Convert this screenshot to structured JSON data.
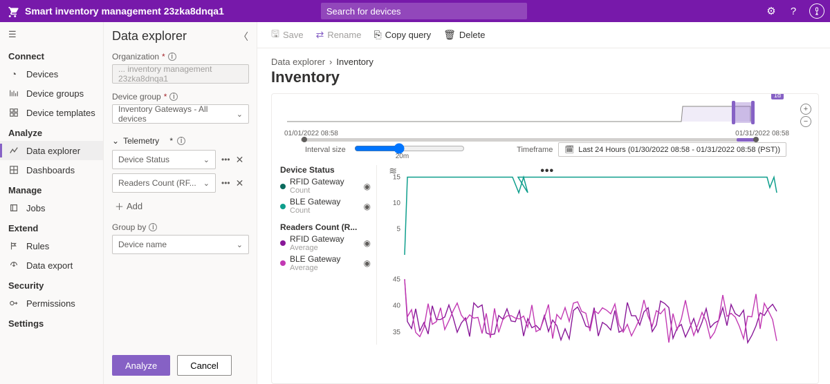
{
  "topbar": {
    "app_title": "Smart inventory management 23zka8dnqa1",
    "search_placeholder": "Search for devices"
  },
  "nav": {
    "sections": {
      "connect": "Connect",
      "analyze": "Analyze",
      "manage": "Manage",
      "extend": "Extend",
      "security": "Security",
      "settings": "Settings"
    },
    "items": {
      "devices": "Devices",
      "device_groups": "Device groups",
      "device_templates": "Device templates",
      "data_explorer": "Data explorer",
      "dashboards": "Dashboards",
      "jobs": "Jobs",
      "rules": "Rules",
      "data_export": "Data export",
      "permissions": "Permissions"
    }
  },
  "data_explorer": {
    "title": "Data explorer",
    "labels": {
      "organization": "Organization",
      "device_group": "Device group",
      "telemetry": "Telemetry",
      "group_by": "Group by",
      "add": "Add"
    },
    "org_value": "... inventory management 23zka8dnqa1",
    "device_group_value": "Inventory Gateways - All devices",
    "telemetry": [
      {
        "label": "Device Status"
      },
      {
        "label": "Readers Count (RF..."
      }
    ],
    "group_by_value": "Device name",
    "buttons": {
      "analyze": "Analyze",
      "cancel": "Cancel"
    }
  },
  "cmdbar": {
    "save": "Save",
    "rename": "Rename",
    "copy": "Copy query",
    "delete": "Delete"
  },
  "page": {
    "crumb_root": "Data explorer",
    "crumb_current": "Inventory",
    "title": "Inventory",
    "timeline_start": "01/01/2022 08:58",
    "timeline_end": "01/31/2022 08:58",
    "timeline_badge": "1d",
    "interval_label": "Interval size",
    "interval_value": "20m",
    "timeframe_label": "Timeframe",
    "timeframe_value": "Last 24 Hours (01/30/2022 08:58 - 01/31/2022 08:58 (PST))"
  },
  "legend": {
    "group1": {
      "title": "Device Status",
      "a": "RFID Gateway",
      "a_sub": "Count",
      "b": "BLE Gateway",
      "b_sub": "Count"
    },
    "group2": {
      "title": "Readers Count (R...",
      "a": "RFID Gateway",
      "a_sub": "Average",
      "b": "BLE Gateway",
      "b_sub": "Average"
    }
  },
  "colors": {
    "brand": "#7719aa",
    "accent": "#8661c5",
    "teal_dark": "#0b6a5d",
    "teal": "#0e9e8c",
    "magenta_dark": "#881798",
    "magenta": "#c239b3"
  },
  "chart_data": [
    {
      "type": "line",
      "title": "Device Status",
      "ylabel": "Count",
      "ylim": [
        0,
        16
      ],
      "series": [
        {
          "name": "RFID Gateway",
          "color": "#0b6a5d"
        },
        {
          "name": "BLE Gateway",
          "color": "#0e9e8c"
        }
      ],
      "yticks": [
        5,
        10,
        15
      ],
      "note": "single flat line near y≈15 with one brief dip to ~12 around x≈0.3"
    },
    {
      "type": "line",
      "title": "Readers Count (RFID/BLE)",
      "ylabel": "Average",
      "ylim": [
        32,
        47
      ],
      "yticks": [
        35,
        40,
        45
      ],
      "series": [
        {
          "name": "RFID Gateway",
          "color": "#881798"
        },
        {
          "name": "BLE Gateway",
          "color": "#c239b3"
        }
      ],
      "note": "two noisy overlapping lines oscillating ~35–40, initial spike to ~45"
    }
  ]
}
